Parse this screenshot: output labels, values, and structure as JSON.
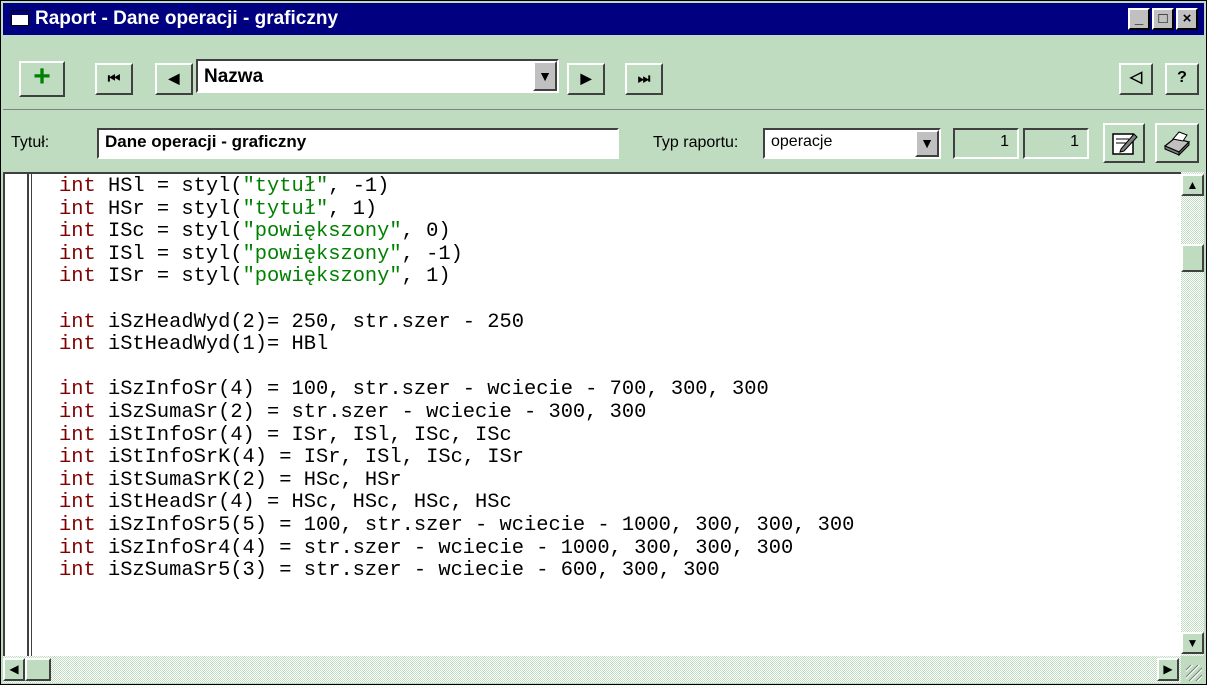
{
  "window": {
    "title": "Raport - Dane operacji - graficzny",
    "controls": {
      "minimize": "_",
      "maximize": "□",
      "close": "×"
    }
  },
  "toolbar": {
    "add_label": "+",
    "first_label": "⏮",
    "prev_label": "◀",
    "next_label": "▶",
    "last_label": "⏭",
    "name_value": "Nazwa",
    "dropdown_arrow": "▼",
    "collapse_label": "◁",
    "help_label": "?"
  },
  "form": {
    "title_label": "Tytuł:",
    "title_value": "Dane operacji - graficzny",
    "type_label": "Typ raportu:",
    "type_value": "operacje",
    "num1": "1",
    "num2": "1"
  },
  "code_lines": [
    [
      {
        "t": "int",
        "c": "kw"
      },
      {
        "t": " HSl = styl("
      },
      {
        "t": "\"tytuł\"",
        "c": "str"
      },
      {
        "t": ", -1)"
      }
    ],
    [
      {
        "t": "int",
        "c": "kw"
      },
      {
        "t": " HSr = styl("
      },
      {
        "t": "\"tytuł\"",
        "c": "str"
      },
      {
        "t": ", 1)"
      }
    ],
    [
      {
        "t": "int",
        "c": "kw"
      },
      {
        "t": " ISc = styl("
      },
      {
        "t": "\"powiększony\"",
        "c": "str"
      },
      {
        "t": ", 0)"
      }
    ],
    [
      {
        "t": "int",
        "c": "kw"
      },
      {
        "t": " ISl = styl("
      },
      {
        "t": "\"powiększony\"",
        "c": "str"
      },
      {
        "t": ", -1)"
      }
    ],
    [
      {
        "t": "int",
        "c": "kw"
      },
      {
        "t": " ISr = styl("
      },
      {
        "t": "\"powiększony\"",
        "c": "str"
      },
      {
        "t": ", 1)"
      }
    ],
    [],
    [
      {
        "t": "int",
        "c": "kw"
      },
      {
        "t": " iSzHeadWyd(2)= 250, str.szer - 250"
      }
    ],
    [
      {
        "t": "int",
        "c": "kw"
      },
      {
        "t": " iStHeadWyd(1)= HBl"
      }
    ],
    [],
    [
      {
        "t": "int",
        "c": "kw"
      },
      {
        "t": " iSzInfoSr(4) = 100, str.szer - wciecie - 700, 300, 300"
      }
    ],
    [
      {
        "t": "int",
        "c": "kw"
      },
      {
        "t": " iSzSumaSr(2) = str.szer - wciecie - 300, 300"
      }
    ],
    [
      {
        "t": "int",
        "c": "kw"
      },
      {
        "t": " iStInfoSr(4) = ISr, ISl, ISc, ISc"
      }
    ],
    [
      {
        "t": "int",
        "c": "kw"
      },
      {
        "t": " iStInfoSrK(4) = ISr, ISl, ISc, ISr"
      }
    ],
    [
      {
        "t": "int",
        "c": "kw"
      },
      {
        "t": " iStSumaSrK(2) = HSc, HSr"
      }
    ],
    [
      {
        "t": "int",
        "c": "kw"
      },
      {
        "t": " iStHeadSr(4) = HSc, HSc, HSc, HSc"
      }
    ],
    [
      {
        "t": "int",
        "c": "kw"
      },
      {
        "t": " iSzInfoSr5(5) = 100, str.szer - wciecie - 1000, 300, 300, 300"
      }
    ],
    [
      {
        "t": "int",
        "c": "kw"
      },
      {
        "t": " iSzInfoSr4(4) = str.szer - wciecie - 1000, 300, 300, 300"
      }
    ],
    [
      {
        "t": "int",
        "c": "kw"
      },
      {
        "t": " iSzSumaSr5(3) = str.szer - wciecie - 600, 300, 300"
      }
    ]
  ],
  "scroll": {
    "up": "▲",
    "down": "▼",
    "left": "◀",
    "right": "▶"
  },
  "colors": {
    "background": "#c0dcc0",
    "titlebar": "#000080",
    "keyword": "#800000",
    "string": "#008000"
  },
  "icons": [
    "window-icon",
    "add-icon",
    "first-record-icon",
    "prev-record-icon",
    "next-record-icon",
    "last-record-icon",
    "collapse-icon",
    "help-icon",
    "edit-icon",
    "print-icon"
  ]
}
